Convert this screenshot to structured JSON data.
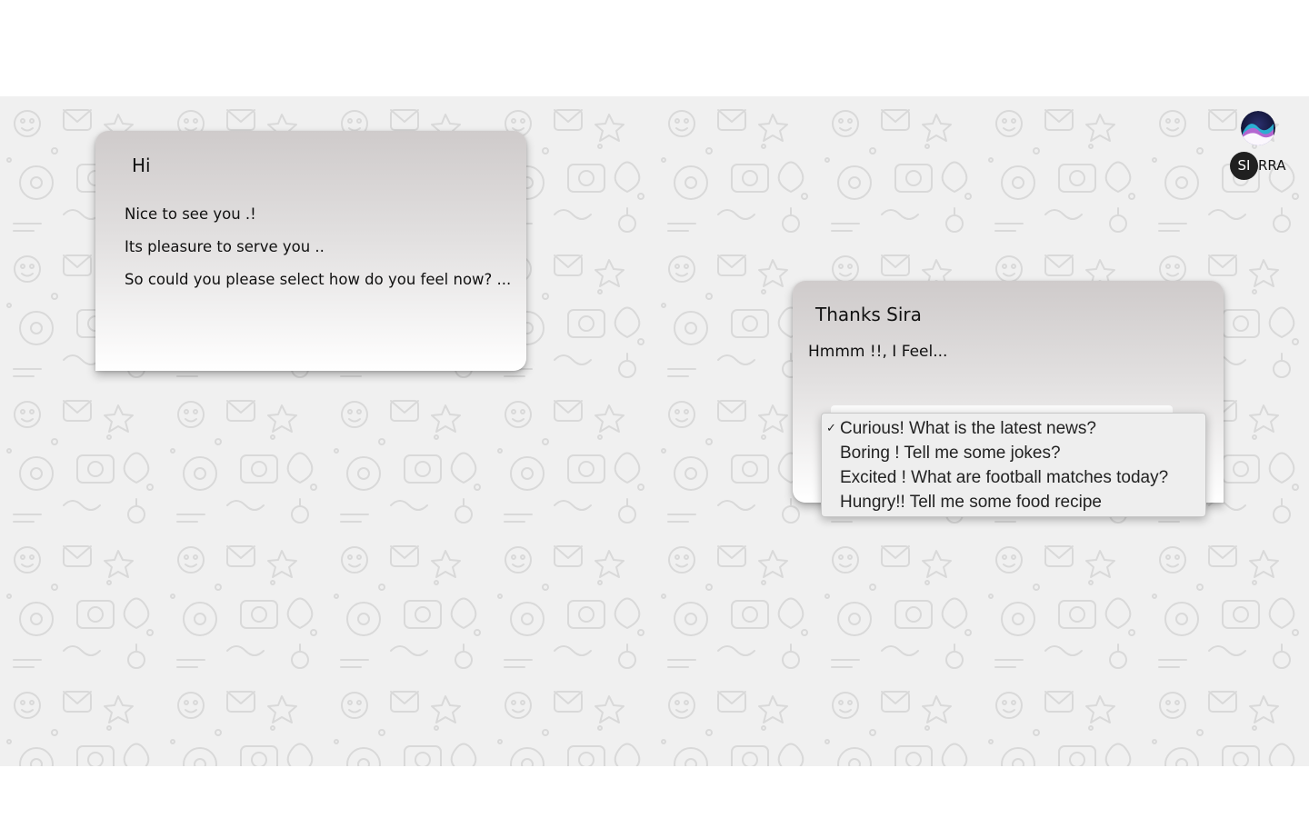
{
  "brand": {
    "badge_text": "SI",
    "name_rest": "RRA",
    "icon": "sirra-orb-icon"
  },
  "bot_message": {
    "title": "Hi",
    "lines": [
      "Nice to see you .!",
      "Its pleasure to serve you ..",
      "So could you please select how do you feel now? ..."
    ]
  },
  "user_message": {
    "title": "Thanks Sira",
    "prompt": "Hmmm !!, I Feel...",
    "dropdown": {
      "selected_index": 0,
      "check_icon": "checkmark-icon",
      "options": [
        "Curious! What is the latest news?",
        "Boring ! Tell me some jokes?",
        "Excited ! What are football matches today?",
        "Hungry!! Tell me some food recipe"
      ]
    }
  },
  "colors": {
    "card_top": "#cfcbcb",
    "card_bottom": "#ffffff",
    "chat_background": "#f0f0f0",
    "doodle_stroke": "#d9d9d9",
    "badge": "#202020"
  }
}
